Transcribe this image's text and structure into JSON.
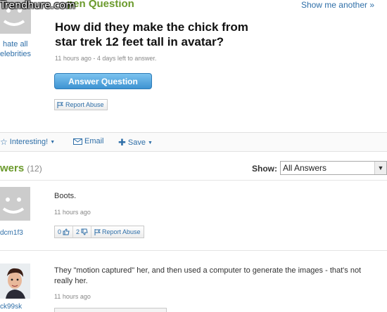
{
  "watermark": "Trendhure.com",
  "header": {
    "title_fragment": "pen Question",
    "show_another": "Show me another »"
  },
  "asker": {
    "name_line1": "hate all",
    "name_line2": "elebrities"
  },
  "question": {
    "title": "How did they make the chick from star trek 12 feet tall in avatar?",
    "meta": "11 hours ago - 4 days left to answer.",
    "answer_button": "Answer Question",
    "report_abuse": "Report Abuse"
  },
  "toolbar": {
    "interesting": "Interesting!",
    "email": "Email",
    "save": "Save"
  },
  "answers_section": {
    "heading_fragment": "wers",
    "count": "(12)",
    "show_label": "Show:",
    "filter_value": "All Answers"
  },
  "answers": [
    {
      "user": "dcm1f3",
      "text": "Boots.",
      "meta": "11 hours ago",
      "thumbs_up": "0",
      "thumbs_down": "2",
      "report": "Report Abuse"
    },
    {
      "user": "ck99sk",
      "text": "They \"motion captured\" her, and then used a computer to generate the images - that's not really her.",
      "meta": "11 hours ago"
    }
  ],
  "colors": {
    "accent_green": "#6b9a2c",
    "link_blue": "#2f6fa8",
    "button_blue": "#3d93d2"
  }
}
